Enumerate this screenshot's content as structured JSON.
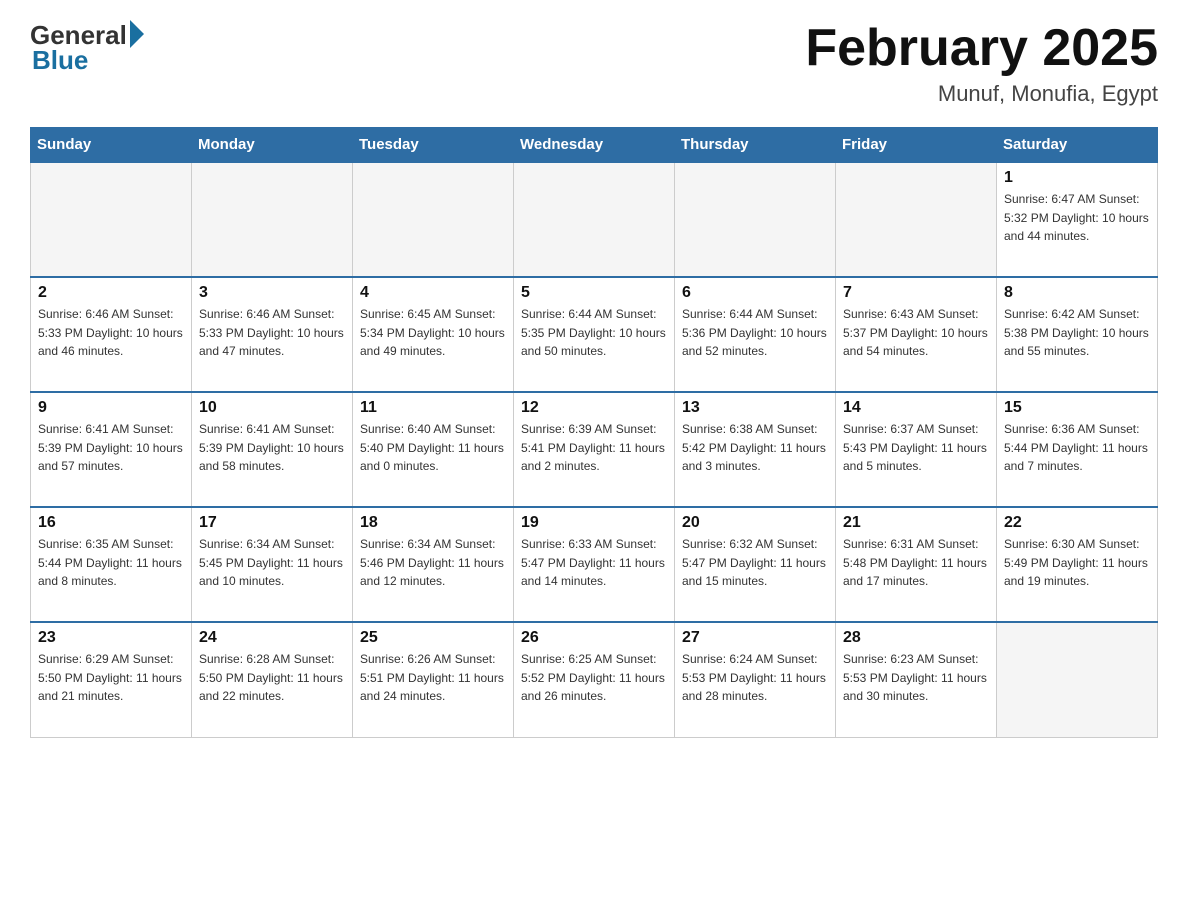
{
  "header": {
    "logo_general": "General",
    "logo_blue": "Blue",
    "month_title": "February 2025",
    "location": "Munuf, Monufia, Egypt"
  },
  "weekdays": [
    "Sunday",
    "Monday",
    "Tuesday",
    "Wednesday",
    "Thursday",
    "Friday",
    "Saturday"
  ],
  "weeks": [
    [
      {
        "day": "",
        "info": ""
      },
      {
        "day": "",
        "info": ""
      },
      {
        "day": "",
        "info": ""
      },
      {
        "day": "",
        "info": ""
      },
      {
        "day": "",
        "info": ""
      },
      {
        "day": "",
        "info": ""
      },
      {
        "day": "1",
        "info": "Sunrise: 6:47 AM\nSunset: 5:32 PM\nDaylight: 10 hours\nand 44 minutes."
      }
    ],
    [
      {
        "day": "2",
        "info": "Sunrise: 6:46 AM\nSunset: 5:33 PM\nDaylight: 10 hours\nand 46 minutes."
      },
      {
        "day": "3",
        "info": "Sunrise: 6:46 AM\nSunset: 5:33 PM\nDaylight: 10 hours\nand 47 minutes."
      },
      {
        "day": "4",
        "info": "Sunrise: 6:45 AM\nSunset: 5:34 PM\nDaylight: 10 hours\nand 49 minutes."
      },
      {
        "day": "5",
        "info": "Sunrise: 6:44 AM\nSunset: 5:35 PM\nDaylight: 10 hours\nand 50 minutes."
      },
      {
        "day": "6",
        "info": "Sunrise: 6:44 AM\nSunset: 5:36 PM\nDaylight: 10 hours\nand 52 minutes."
      },
      {
        "day": "7",
        "info": "Sunrise: 6:43 AM\nSunset: 5:37 PM\nDaylight: 10 hours\nand 54 minutes."
      },
      {
        "day": "8",
        "info": "Sunrise: 6:42 AM\nSunset: 5:38 PM\nDaylight: 10 hours\nand 55 minutes."
      }
    ],
    [
      {
        "day": "9",
        "info": "Sunrise: 6:41 AM\nSunset: 5:39 PM\nDaylight: 10 hours\nand 57 minutes."
      },
      {
        "day": "10",
        "info": "Sunrise: 6:41 AM\nSunset: 5:39 PM\nDaylight: 10 hours\nand 58 minutes."
      },
      {
        "day": "11",
        "info": "Sunrise: 6:40 AM\nSunset: 5:40 PM\nDaylight: 11 hours\nand 0 minutes."
      },
      {
        "day": "12",
        "info": "Sunrise: 6:39 AM\nSunset: 5:41 PM\nDaylight: 11 hours\nand 2 minutes."
      },
      {
        "day": "13",
        "info": "Sunrise: 6:38 AM\nSunset: 5:42 PM\nDaylight: 11 hours\nand 3 minutes."
      },
      {
        "day": "14",
        "info": "Sunrise: 6:37 AM\nSunset: 5:43 PM\nDaylight: 11 hours\nand 5 minutes."
      },
      {
        "day": "15",
        "info": "Sunrise: 6:36 AM\nSunset: 5:44 PM\nDaylight: 11 hours\nand 7 minutes."
      }
    ],
    [
      {
        "day": "16",
        "info": "Sunrise: 6:35 AM\nSunset: 5:44 PM\nDaylight: 11 hours\nand 8 minutes."
      },
      {
        "day": "17",
        "info": "Sunrise: 6:34 AM\nSunset: 5:45 PM\nDaylight: 11 hours\nand 10 minutes."
      },
      {
        "day": "18",
        "info": "Sunrise: 6:34 AM\nSunset: 5:46 PM\nDaylight: 11 hours\nand 12 minutes."
      },
      {
        "day": "19",
        "info": "Sunrise: 6:33 AM\nSunset: 5:47 PM\nDaylight: 11 hours\nand 14 minutes."
      },
      {
        "day": "20",
        "info": "Sunrise: 6:32 AM\nSunset: 5:47 PM\nDaylight: 11 hours\nand 15 minutes."
      },
      {
        "day": "21",
        "info": "Sunrise: 6:31 AM\nSunset: 5:48 PM\nDaylight: 11 hours\nand 17 minutes."
      },
      {
        "day": "22",
        "info": "Sunrise: 6:30 AM\nSunset: 5:49 PM\nDaylight: 11 hours\nand 19 minutes."
      }
    ],
    [
      {
        "day": "23",
        "info": "Sunrise: 6:29 AM\nSunset: 5:50 PM\nDaylight: 11 hours\nand 21 minutes."
      },
      {
        "day": "24",
        "info": "Sunrise: 6:28 AM\nSunset: 5:50 PM\nDaylight: 11 hours\nand 22 minutes."
      },
      {
        "day": "25",
        "info": "Sunrise: 6:26 AM\nSunset: 5:51 PM\nDaylight: 11 hours\nand 24 minutes."
      },
      {
        "day": "26",
        "info": "Sunrise: 6:25 AM\nSunset: 5:52 PM\nDaylight: 11 hours\nand 26 minutes."
      },
      {
        "day": "27",
        "info": "Sunrise: 6:24 AM\nSunset: 5:53 PM\nDaylight: 11 hours\nand 28 minutes."
      },
      {
        "day": "28",
        "info": "Sunrise: 6:23 AM\nSunset: 5:53 PM\nDaylight: 11 hours\nand 30 minutes."
      },
      {
        "day": "",
        "info": ""
      }
    ]
  ]
}
